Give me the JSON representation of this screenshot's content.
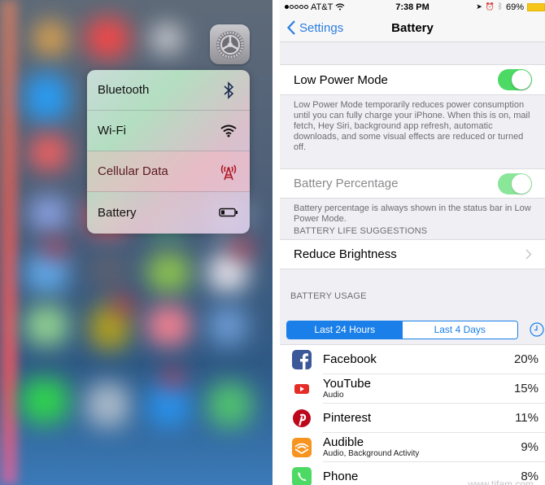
{
  "left_panel": {
    "app_icon": "settings-icon",
    "quick_actions": [
      {
        "label": "Bluetooth",
        "icon": "bluetooth-icon"
      },
      {
        "label": "Wi-Fi",
        "icon": "wifi-icon"
      },
      {
        "label": "Cellular Data",
        "icon": "cellular-antenna-icon"
      },
      {
        "label": "Battery",
        "icon": "battery-icon"
      }
    ]
  },
  "status_bar": {
    "carrier": "AT&T",
    "time": "7:38 PM",
    "battery_percent": "69%"
  },
  "nav": {
    "back_label": "Settings",
    "title": "Battery"
  },
  "low_power": {
    "label": "Low Power Mode",
    "enabled": true,
    "footnote": "Low Power Mode temporarily reduces power consumption until you can fully charge your iPhone. When this is on, mail fetch, Hey Siri, background app refresh, automatic downloads, and some visual effects are reduced or turned off."
  },
  "battery_percentage": {
    "label": "Battery Percentage",
    "enabled": true,
    "footnote": "Battery percentage is always shown in the status bar in Low Power Mode."
  },
  "suggestions": {
    "header": "BATTERY LIFE SUGGESTIONS",
    "items": [
      {
        "label": "Reduce Brightness"
      }
    ]
  },
  "usage": {
    "header": "BATTERY USAGE",
    "segments": [
      {
        "label": "Last 24 Hours",
        "selected": true
      },
      {
        "label": "Last 4 Days",
        "selected": false
      }
    ],
    "apps": [
      {
        "name": "Facebook",
        "subtitle": "",
        "percent": "20%",
        "color": "#3b5998"
      },
      {
        "name": "YouTube",
        "subtitle": "Audio",
        "percent": "15%",
        "color": "#e52d27"
      },
      {
        "name": "Pinterest",
        "subtitle": "",
        "percent": "11%",
        "color": "#bd081c"
      },
      {
        "name": "Audible",
        "subtitle": "Audio, Background Activity",
        "percent": "9%",
        "color": "#f7931e"
      },
      {
        "name": "Phone",
        "subtitle": "",
        "percent": "8%",
        "color": "#4cd964"
      }
    ]
  },
  "watermark": "www.tifam.com"
}
